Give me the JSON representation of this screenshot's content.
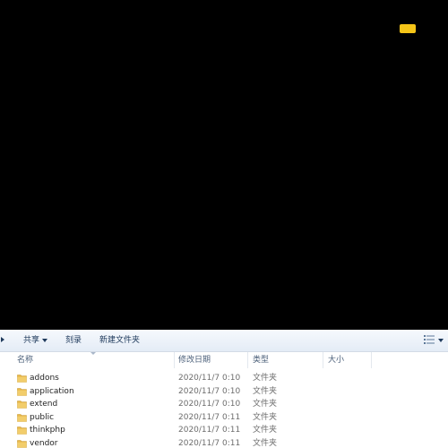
{
  "toolbar": {
    "share_label": "共享",
    "burn_label": "刻录",
    "new_folder_label": "新建文件夹"
  },
  "columns": {
    "name": "名称",
    "date": "修改日期",
    "type": "类型",
    "size": "大小"
  },
  "files": [
    {
      "name": "addons",
      "date": "2020/11/7 0:10",
      "type": "文件夹",
      "size": ""
    },
    {
      "name": "application",
      "date": "2020/11/7 0:10",
      "type": "文件夹",
      "size": ""
    },
    {
      "name": "extend",
      "date": "2020/11/7 0:10",
      "type": "文件夹",
      "size": ""
    },
    {
      "name": "public",
      "date": "2020/11/7 0:11",
      "type": "文件夹",
      "size": ""
    },
    {
      "name": "thinkphp",
      "date": "2020/11/7 0:11",
      "type": "文件夹",
      "size": ""
    },
    {
      "name": "vendor",
      "date": "2020/11/7 0:11",
      "type": "文件夹",
      "size": ""
    }
  ],
  "icons": {
    "folder": "folder-icon",
    "view": "view-options-icon"
  },
  "colors": {
    "badge": "#f5c518",
    "toolbar_text": "#1e395b",
    "folder": "#e9b949"
  }
}
